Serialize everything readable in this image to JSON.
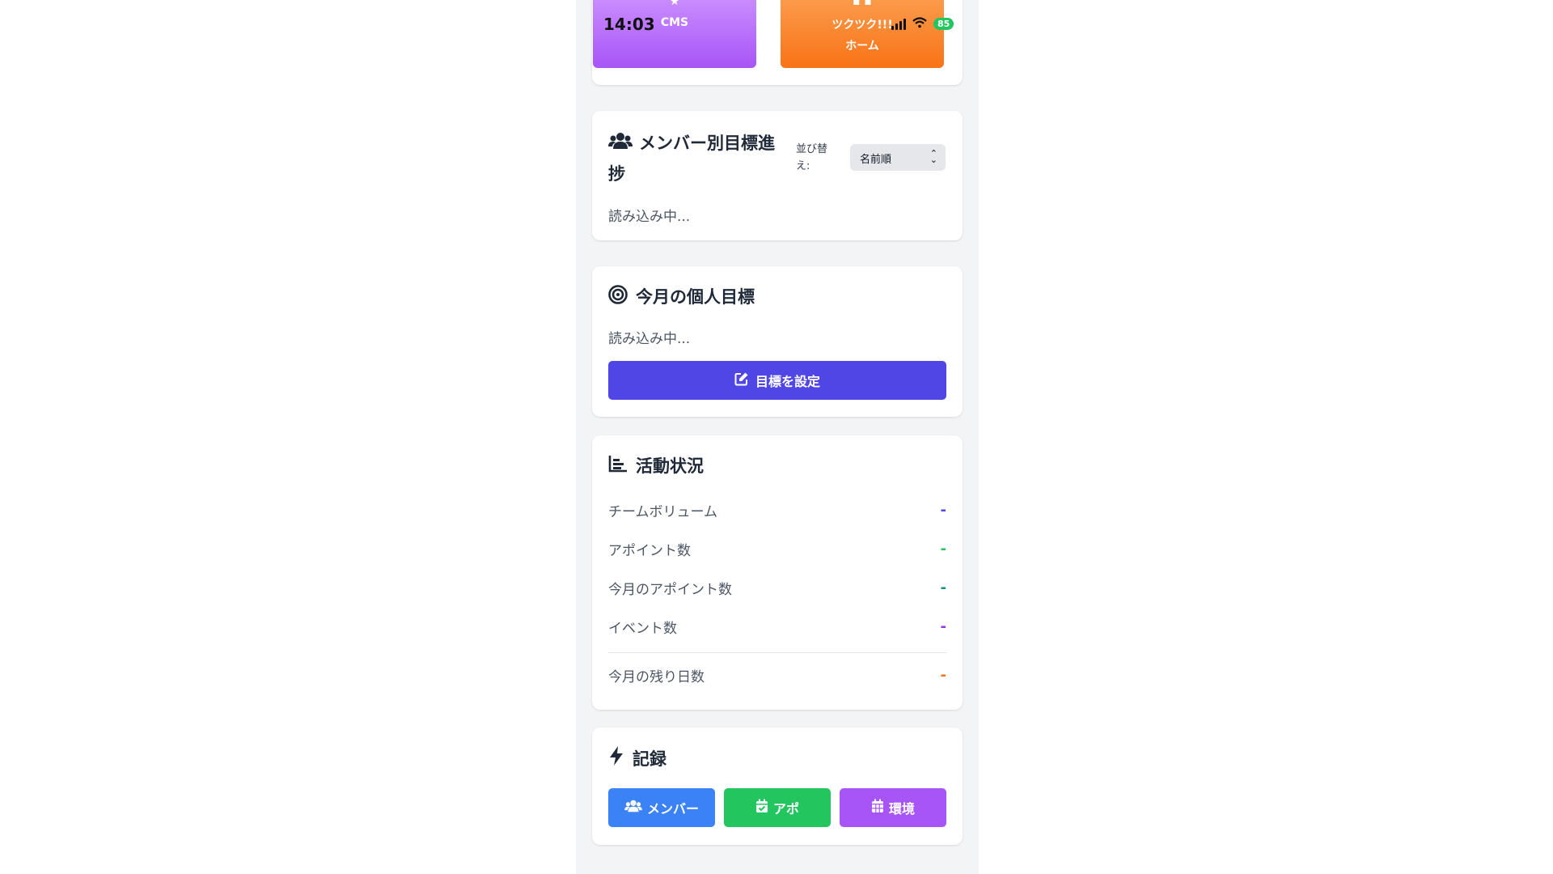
{
  "status_bar": {
    "time": "14:03",
    "battery": "85"
  },
  "top_tiles": [
    {
      "label": "CMS",
      "icon": "star-icon",
      "color": "#a855f7"
    },
    {
      "label_line1": "ツクツク!!!",
      "label_line2": "ホーム",
      "icon": "grid-icon",
      "color": "#f97316"
    }
  ],
  "members_card": {
    "title": "メンバー別目標進捗",
    "sort_label": "並び替え:",
    "sort_value": "名前順",
    "loading": "読み込み中..."
  },
  "goal_card": {
    "title": "今月の個人目標",
    "loading": "読み込み中...",
    "button_label": "目標を設定"
  },
  "activity_card": {
    "title": "活動状況",
    "rows": [
      {
        "label": "チームボリューム",
        "value": "-",
        "color": "#4f46e5"
      },
      {
        "label": "アポイント数",
        "value": "-",
        "color": "#22c55e"
      },
      {
        "label": "今月のアポイント数",
        "value": "-",
        "color": "#0d9488"
      },
      {
        "label": "イベント数",
        "value": "-",
        "color": "#9333ea"
      },
      {
        "label": "今月の残り日数",
        "value": "-",
        "color": "#f97316"
      }
    ]
  },
  "record_card": {
    "title": "記録",
    "buttons": [
      {
        "label": "メンバー",
        "color": "#3b82f6"
      },
      {
        "label": "アポ",
        "color": "#22c55e"
      },
      {
        "label": "環境",
        "color": "#a855f7"
      }
    ]
  }
}
